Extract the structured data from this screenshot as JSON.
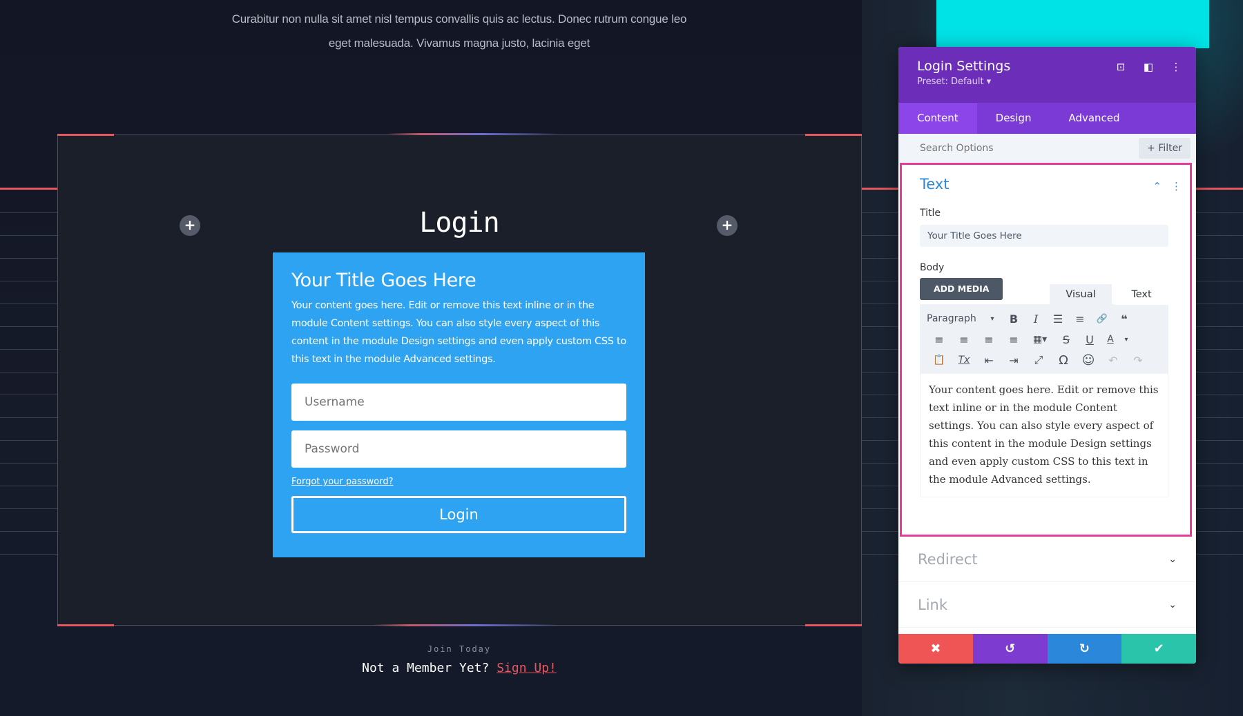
{
  "page": {
    "intro_text": "Curabitur non nulla sit amet nisl tempus convallis quis ac lectus. Donec rutrum congue leo eget malesuada. Vivamus magna justo, lacinia eget",
    "section_heading": "Login",
    "add_icon": "+",
    "join_label": "Join Today",
    "member_prefix": "Not a Member Yet?",
    "signup_link": "Sign Up!"
  },
  "login_module": {
    "title": "Your Title Goes Here",
    "body": "Your content goes here. Edit or remove this text inline or in the module Content settings. You can also style every aspect of this content in the module Design settings and even apply custom CSS to this text in the module Advanced settings.",
    "username_placeholder": "Username",
    "password_placeholder": "Password",
    "forgot_link": "Forgot your password?",
    "login_button": "Login",
    "background_color": "#2ea3f2"
  },
  "settings_panel": {
    "title": "Login Settings",
    "preset": "Preset: Default ▾",
    "header_icons": [
      "focus-icon",
      "split-view-icon",
      "more-icon"
    ],
    "header_glyphs": {
      "focus": "⊡",
      "split": "◧",
      "more": "⋮"
    },
    "tabs": [
      {
        "label": "Content",
        "active": true
      },
      {
        "label": "Design",
        "active": false
      },
      {
        "label": "Advanced",
        "active": false
      }
    ],
    "search_placeholder": "Search Options",
    "filter_label": "+ Filter",
    "text_section": {
      "title": "Text",
      "collapse_glyph": "⌃",
      "menu_glyph": "⋮",
      "title_label": "Title",
      "title_value": "Your Title Goes Here",
      "body_label": "Body",
      "add_media": "ADD MEDIA",
      "editor_tabs": [
        "Visual",
        "Text"
      ],
      "format_select": "Paragraph",
      "toolbar_row1": [
        "▾",
        "B",
        "I",
        "☰",
        "≡",
        "🔗",
        "❝"
      ],
      "toolbar_row2": [
        "≡",
        "≡",
        "≡",
        "≡",
        "▦▾",
        "S",
        "U",
        "A",
        "▾"
      ],
      "toolbar_row3": [
        "📋",
        "Tx",
        "⇤",
        "⇥",
        "⤢",
        "Ω",
        "☺",
        "↶",
        "↷"
      ],
      "body_value": "Your content goes here. Edit or remove this text inline or in the module Content settings. You can also style every aspect of this content in the module Design settings and even apply custom CSS to this text in the module Advanced settings."
    },
    "collapsed_sections": [
      {
        "label": "Redirect",
        "chevron": "⌄"
      },
      {
        "label": "Link",
        "chevron": "⌄"
      }
    ],
    "footer": {
      "cancel": "✖",
      "undo": "↺",
      "redo": "↻",
      "save": "✔",
      "colors": {
        "cancel": "#ef5555",
        "undo": "#7e3bd0",
        "redo": "#2b87da",
        "save": "#29c4a9"
      }
    },
    "colors": {
      "header": "#6c2eb9",
      "tabs": "#7b3ad6",
      "active_tab": "#8b45e8",
      "section_border": "#e73b9b",
      "section_title": "#2b87da"
    }
  }
}
